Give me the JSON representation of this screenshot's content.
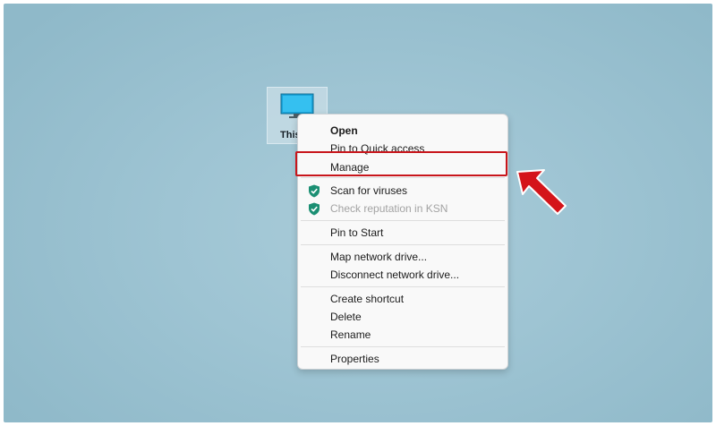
{
  "desktop": {
    "icon": {
      "label": "This",
      "icon_name": "monitor-icon"
    }
  },
  "context_menu": {
    "items": [
      {
        "label": "Open",
        "bold": true
      },
      {
        "label": "Pin to Quick access"
      },
      {
        "label": "Manage",
        "highlighted": true
      },
      {
        "label": "Scan for viruses",
        "icon": "shield-check-icon"
      },
      {
        "label": "Check reputation in KSN",
        "icon": "shield-check-icon",
        "disabled": true
      },
      {
        "label": "Pin to Start"
      },
      {
        "label": "Map network drive..."
      },
      {
        "label": "Disconnect network drive..."
      },
      {
        "label": "Create shortcut"
      },
      {
        "label": "Delete"
      },
      {
        "label": "Rename"
      },
      {
        "label": "Properties"
      }
    ]
  },
  "annotation": {
    "highlight_color": "#c8151b",
    "arrow_color": "#d4141a",
    "arrow_icon": "red-arrow-icon"
  },
  "colors": {
    "desktop_background": "#9ec4d3",
    "menu_background": "#f9f9f9",
    "shield": "#1b8f73"
  }
}
